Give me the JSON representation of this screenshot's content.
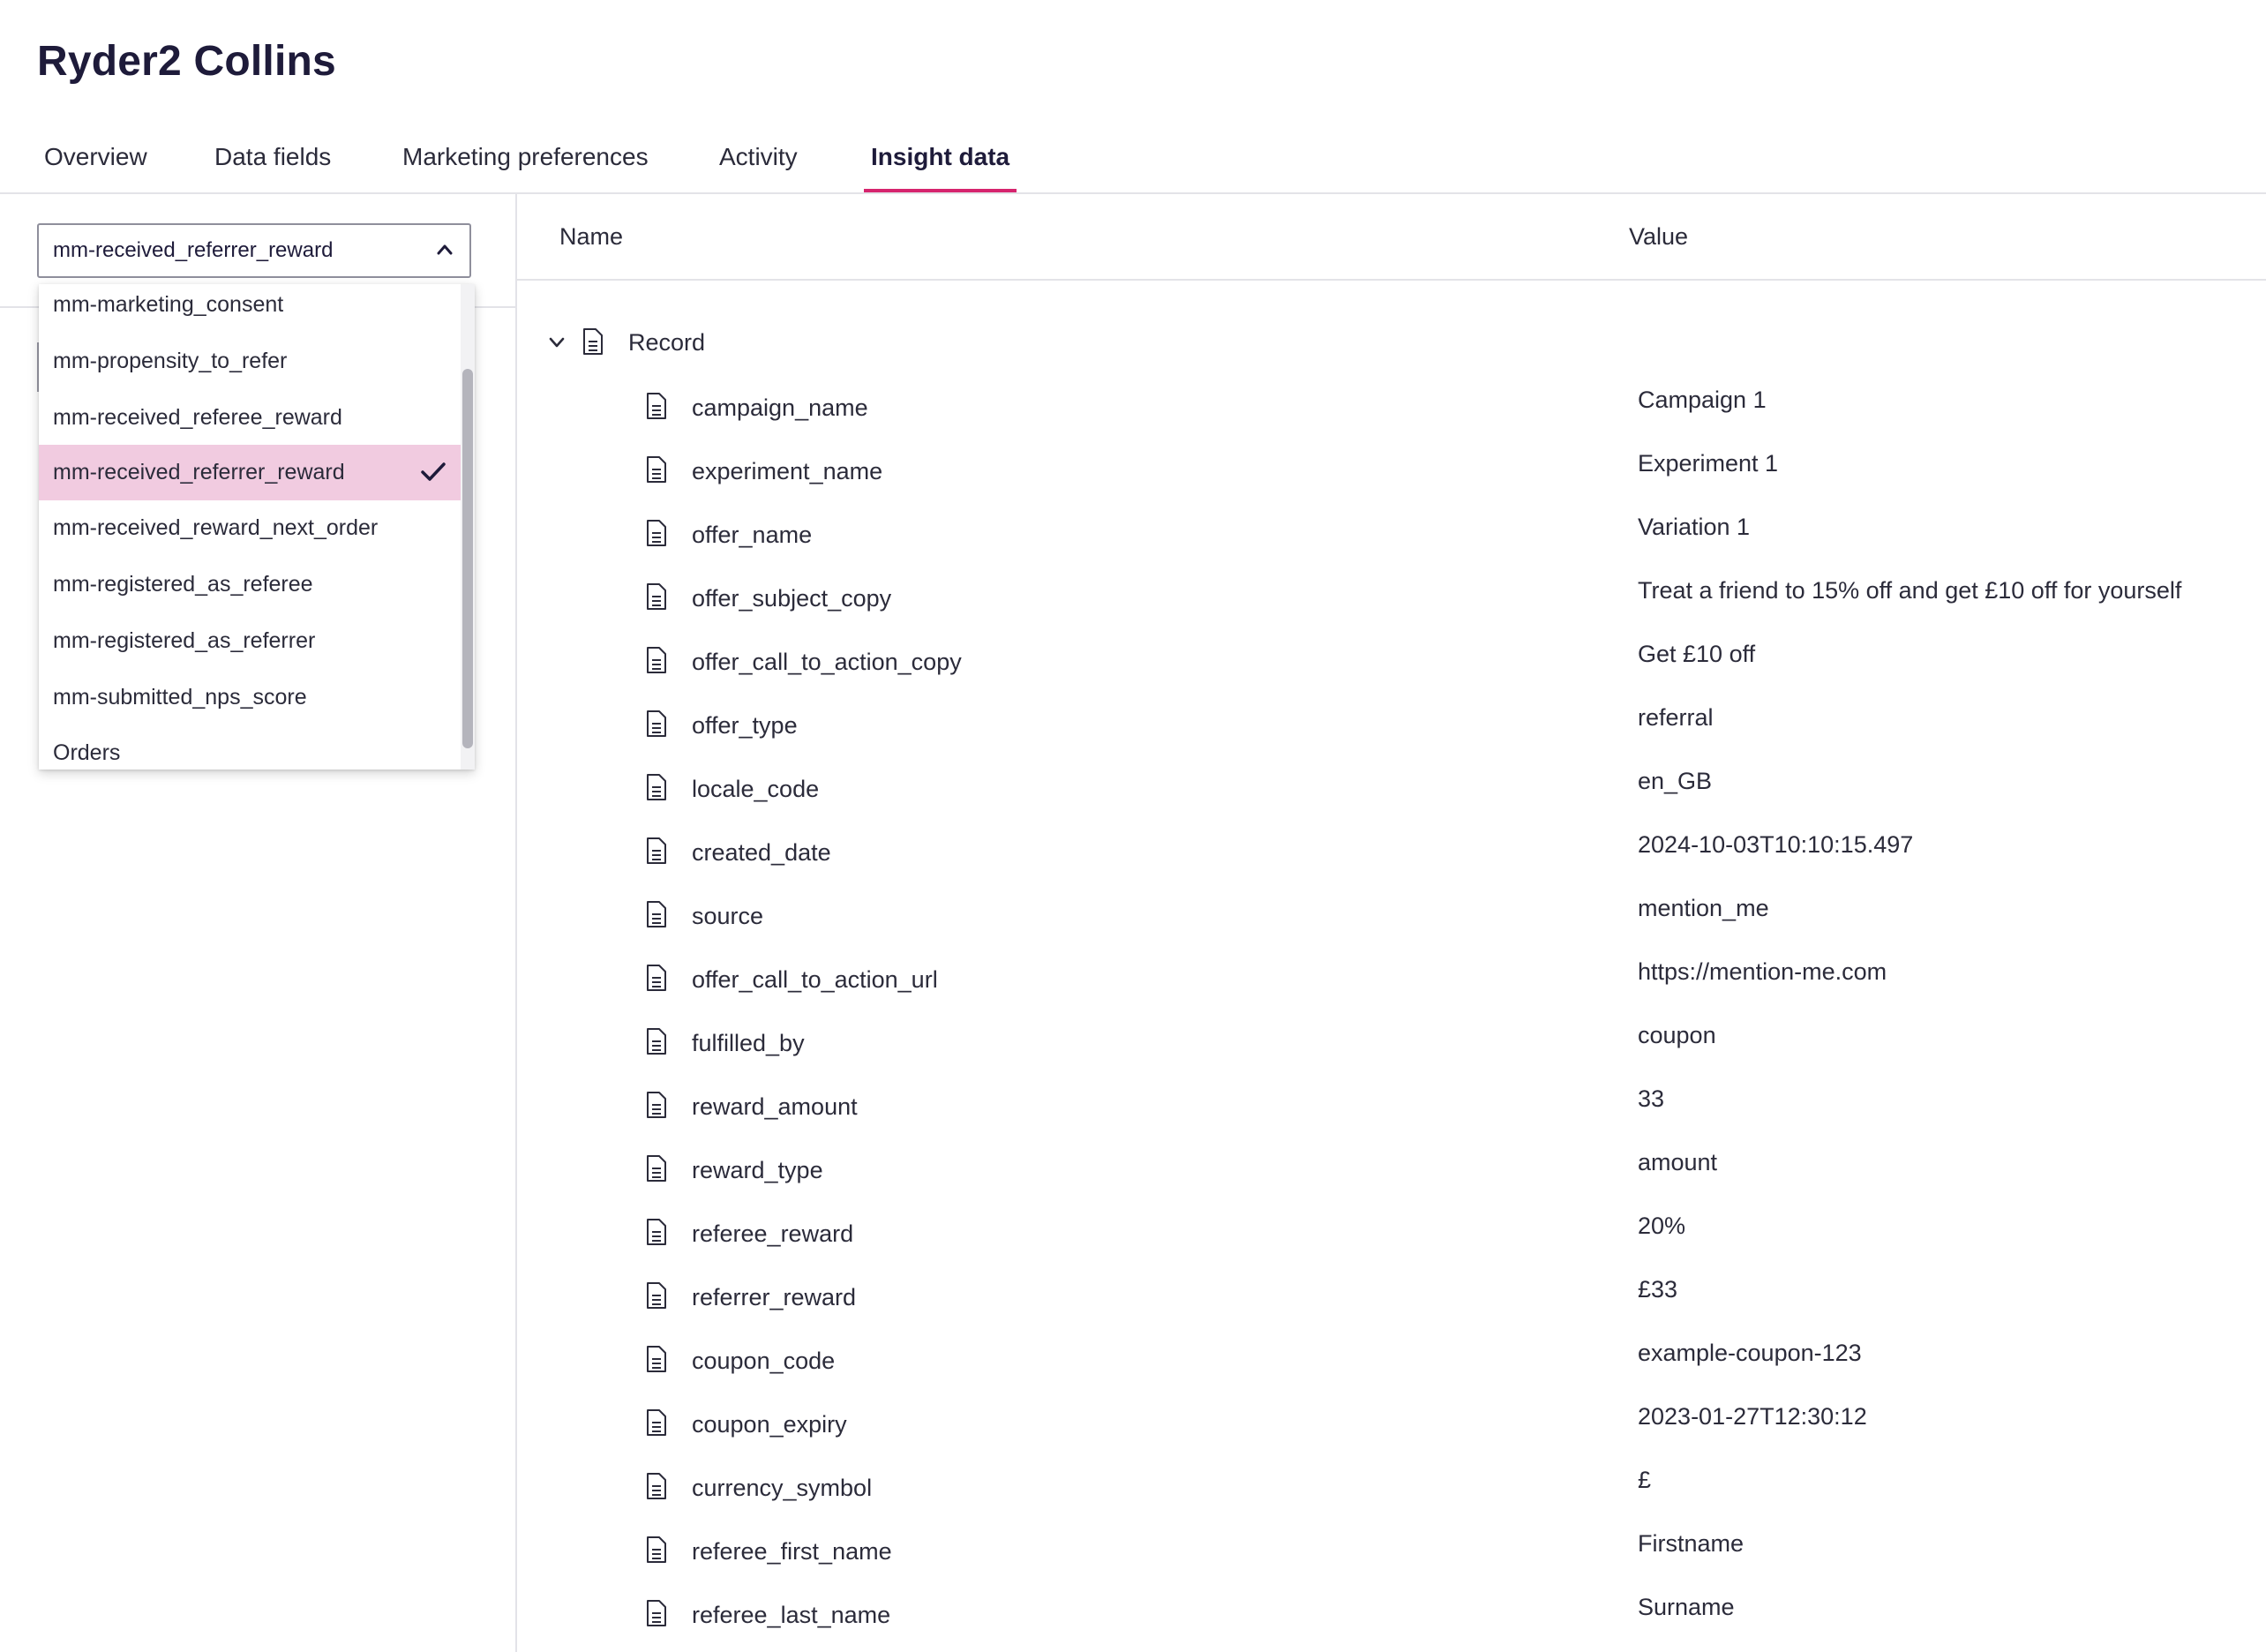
{
  "page": {
    "title": "Ryder2 Collins"
  },
  "tabs": [
    {
      "label": "Overview"
    },
    {
      "label": "Data fields"
    },
    {
      "label": "Marketing preferences"
    },
    {
      "label": "Activity"
    },
    {
      "label": "Insight data",
      "active": true
    }
  ],
  "selector": {
    "value": "mm-received_referrer_reward",
    "options": [
      "mm-marketing_consent",
      "mm-propensity_to_refer",
      "mm-received_referee_reward",
      "mm-received_referrer_reward",
      "mm-received_reward_next_order",
      "mm-registered_as_referee",
      "mm-registered_as_referrer",
      "mm-submitted_nps_score",
      "Orders"
    ],
    "selected_index": 3
  },
  "table": {
    "headers": {
      "name": "Name",
      "value": "Value"
    },
    "record_label": "Record",
    "rows": [
      {
        "name": "campaign_name",
        "value": "Campaign 1"
      },
      {
        "name": "experiment_name",
        "value": "Experiment 1"
      },
      {
        "name": "offer_name",
        "value": "Variation 1"
      },
      {
        "name": "offer_subject_copy",
        "value": "Treat a friend to 15% off and get £10 off for yourself"
      },
      {
        "name": "offer_call_to_action_copy",
        "value": "Get £10 off"
      },
      {
        "name": "offer_type",
        "value": "referral"
      },
      {
        "name": "locale_code",
        "value": "en_GB"
      },
      {
        "name": "created_date",
        "value": "2024-10-03T10:10:15.497"
      },
      {
        "name": "source",
        "value": "mention_me"
      },
      {
        "name": "offer_call_to_action_url",
        "value": "https://mention-me.com"
      },
      {
        "name": "fulfilled_by",
        "value": "coupon"
      },
      {
        "name": "reward_amount",
        "value": "33"
      },
      {
        "name": "reward_type",
        "value": "amount"
      },
      {
        "name": "referee_reward",
        "value": "20%"
      },
      {
        "name": "referrer_reward",
        "value": "£33"
      },
      {
        "name": "coupon_code",
        "value": "example-coupon-123"
      },
      {
        "name": "coupon_expiry",
        "value": "2023-01-27T12:30:12"
      },
      {
        "name": "currency_symbol",
        "value": "£"
      },
      {
        "name": "referee_first_name",
        "value": "Firstname"
      },
      {
        "name": "referee_last_name",
        "value": "Surname"
      }
    ]
  },
  "colors": {
    "accent": "#d6246e",
    "selected_bg": "#f1cbe0",
    "title": "#1e1b3a",
    "text": "#2b2b3a"
  },
  "icons": {
    "select_toggle": "chevron-up-icon",
    "selected_option": "checkmark-icon",
    "record_toggle": "chevron-down-icon",
    "row": "document-icon"
  }
}
